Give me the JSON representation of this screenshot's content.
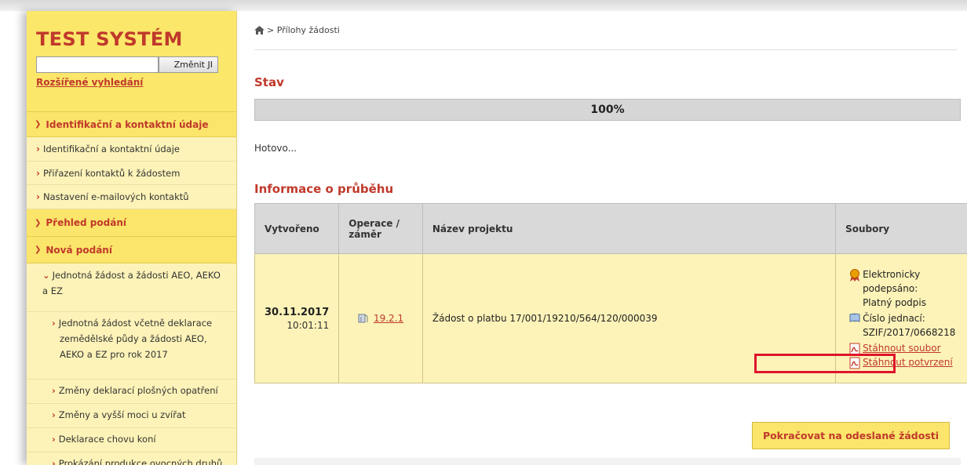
{
  "sidebar": {
    "brand": "TEST SYSTÉM",
    "search_value": "",
    "search_button": "Změnit JI",
    "advanced_search": "Rozšířené vyhledání",
    "sections": [
      {
        "label": "Identifikační a kontaktní údaje"
      },
      {
        "label": "Přehled podání"
      },
      {
        "label": "Nová podání"
      }
    ],
    "items": [
      {
        "label": "Identifikační a kontaktní údaje"
      },
      {
        "label": "Přiřazení kontaktů k žádostem"
      },
      {
        "label": "Nastavení e-mailových kontaktů"
      }
    ],
    "sub": {
      "label": "Jednotná žádost a žádosti AEO, AEKO a EZ"
    },
    "sub2": [
      {
        "label": "Jednotná žádost včetně deklarace zemědělské půdy a žádosti AEO, AEKO a EZ pro rok 2017"
      },
      {
        "label": "Změny deklarací plošných opatření"
      },
      {
        "label": "Změny a vyšší moci u zvířat"
      },
      {
        "label": "Deklarace chovu koní"
      },
      {
        "label": "Prokázání produkce ovocných druhů"
      }
    ]
  },
  "breadcrumb": {
    "current": "Přílohy žádosti"
  },
  "stav": {
    "heading": "Stav",
    "progress": 100,
    "progress_label": "100%",
    "status_text": "Hotovo..."
  },
  "info": {
    "heading": "Informace o průběhu",
    "columns": [
      "Vytvořeno",
      "Operace / záměr",
      "Název projektu",
      "Soubory"
    ],
    "row": {
      "date": "30.11.2017",
      "time": "10:01:11",
      "operation": "19.2.1",
      "project": "Žádost o platbu 17/001/19210/564/120/000039",
      "signed_label": "Elektronicky podepsáno:",
      "signed_value": "Platný podpis",
      "ref_label": "Číslo jednací:",
      "ref_value": "SZIF/2017/0668218",
      "download_file": "Stáhnout soubor",
      "download_confirm": "Stáhnout potvrzení"
    }
  },
  "continue_button": "Pokračovat na odeslané žádosti",
  "colors": {
    "accent": "#c0392b",
    "sidebar_bg": "#fdf3b8",
    "sidebar_header": "#fbe56a",
    "highlight": "#e0142b"
  }
}
